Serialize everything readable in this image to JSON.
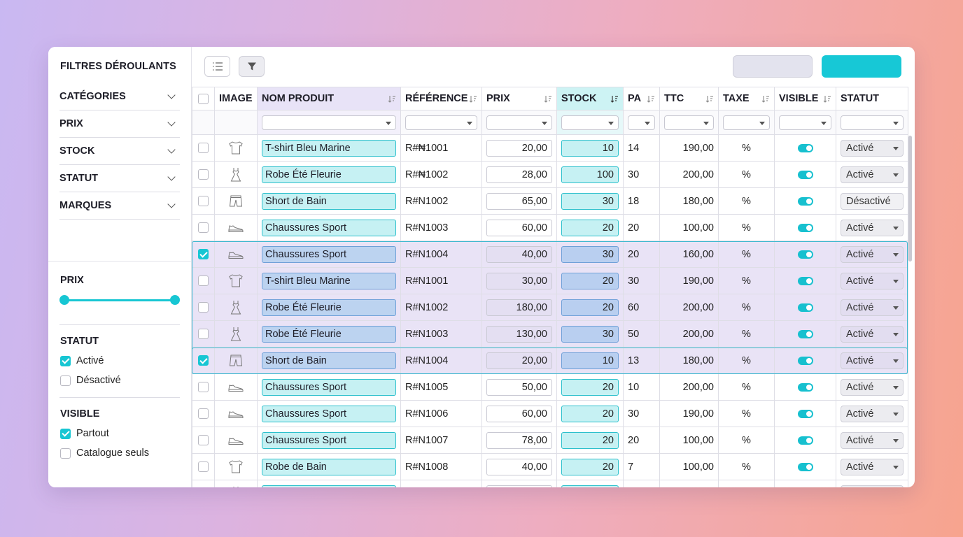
{
  "sidebar": {
    "title": "FILTRES DÉROULANTS",
    "accordions": [
      "CATÉGORIES",
      "PRIX",
      "STOCK",
      "STATUT",
      "MARQUES"
    ],
    "price_heading": "PRIX",
    "price_range": {
      "min_fraction": 0.0,
      "max_fraction": 1.0
    },
    "status_heading": "STATUT",
    "status_options": [
      {
        "label": "Activé",
        "checked": true
      },
      {
        "label": "Désactivé",
        "checked": false
      }
    ],
    "visible_heading": "VISIBLE",
    "visible_options": [
      {
        "label": "Partout",
        "checked": true
      },
      {
        "label": "Catalogue seuls",
        "checked": false
      }
    ]
  },
  "toolbar": {
    "list_icon": "list-icon",
    "filter_icon": "filter-icon"
  },
  "columns": [
    "",
    "IMAGE",
    "NOM PRODUIT",
    "RÉFÉRENCE",
    "PRIX",
    "STOCK",
    "PA",
    "TTC",
    "TAXE",
    "VISIBLE",
    "STATUT"
  ],
  "colors": {
    "accent": "#17c8d6",
    "selection": "#e9e3f6"
  },
  "rows": [
    {
      "checked": false,
      "selected": false,
      "icon": "tshirt-icon",
      "name": "T-shirt Bleu Marine",
      "ref": "R#₦1001",
      "price": "20,00",
      "stock": "10",
      "pa": "14",
      "ttc": "190,00",
      "tax": "%",
      "visible": true,
      "status": "Activé",
      "dropdown": true
    },
    {
      "checked": false,
      "selected": false,
      "icon": "dress-icon",
      "name": "Robe Été Fleurie",
      "ref": "R#₦1002",
      "price": "28,00",
      "stock": "100",
      "pa": "30",
      "ttc": "200,00",
      "tax": "%",
      "visible": true,
      "status": "Activé",
      "dropdown": true
    },
    {
      "checked": false,
      "selected": false,
      "icon": "shorts-icon",
      "name": "Short de Bain",
      "ref": "R#N1002",
      "price": "65,00",
      "stock": "30",
      "pa": "18",
      "ttc": "180,00",
      "tax": "%",
      "visible": true,
      "status": "Désactivé",
      "dropdown": false
    },
    {
      "checked": false,
      "selected": false,
      "icon": "shoe-icon",
      "name": "Chaussures Sport",
      "ref": "R#N1003",
      "price": "60,00",
      "stock": "20",
      "pa": "20",
      "ttc": "100,00",
      "tax": "%",
      "visible": true,
      "status": "Activé",
      "dropdown": true
    },
    {
      "checked": true,
      "selected": true,
      "icon": "shoe-icon",
      "name": "Chaussures Sport",
      "ref": "R#N1004",
      "price": "40,00",
      "stock": "30",
      "pa": "20",
      "ttc": "160,00",
      "tax": "%",
      "visible": true,
      "status": "Activé",
      "dropdown": true
    },
    {
      "checked": false,
      "selected": true,
      "icon": "tshirt-icon",
      "name": "T-shirt Bleu Marine",
      "ref": "R#N1001",
      "price": "30,00",
      "stock": "20",
      "pa": "30",
      "ttc": "190,00",
      "tax": "%",
      "visible": true,
      "status": "Activé",
      "dropdown": true
    },
    {
      "checked": false,
      "selected": true,
      "icon": "dress-icon",
      "name": "Robe Été Fleurie",
      "ref": "R#N1002",
      "price": "180,00",
      "stock": "20",
      "pa": "60",
      "ttc": "200,00",
      "tax": "%",
      "visible": true,
      "status": "Activé",
      "dropdown": true
    },
    {
      "checked": false,
      "selected": true,
      "icon": "dress-icon",
      "name": "Robe Été Fleurie",
      "ref": "R#N1003",
      "price": "130,00",
      "stock": "30",
      "pa": "50",
      "ttc": "200,00",
      "tax": "%",
      "visible": true,
      "status": "Activé",
      "dropdown": true
    },
    {
      "checked": true,
      "selected": true,
      "icon": "shorts-icon",
      "name": "Short de Bain",
      "ref": "R#N1004",
      "price": "20,00",
      "stock": "10",
      "pa": "13",
      "ttc": "180,00",
      "tax": "%",
      "visible": true,
      "status": "Activé",
      "dropdown": true
    },
    {
      "checked": false,
      "selected": false,
      "icon": "shoe-icon",
      "name": "Chaussures Sport",
      "ref": "R#N1005",
      "price": "50,00",
      "stock": "20",
      "pa": "10",
      "ttc": "200,00",
      "tax": "%",
      "visible": true,
      "status": "Activé",
      "dropdown": true
    },
    {
      "checked": false,
      "selected": false,
      "icon": "shoe-icon",
      "name": "Chaussures Sport",
      "ref": "R#N1006",
      "price": "60,00",
      "stock": "20",
      "pa": "30",
      "ttc": "190,00",
      "tax": "%",
      "visible": true,
      "status": "Activé",
      "dropdown": true
    },
    {
      "checked": false,
      "selected": false,
      "icon": "shoe-icon",
      "name": "Chaussures Sport",
      "ref": "R#N1007",
      "price": "78,00",
      "stock": "20",
      "pa": "20",
      "ttc": "100,00",
      "tax": "%",
      "visible": true,
      "status": "Activé",
      "dropdown": true
    },
    {
      "checked": false,
      "selected": false,
      "icon": "tshirt-icon",
      "name": "Robe de Bain",
      "ref": "R#N1008",
      "price": "40,00",
      "stock": "20",
      "pa": "7",
      "ttc": "100,00",
      "tax": "%",
      "visible": true,
      "status": "Activé",
      "dropdown": true
    },
    {
      "checked": false,
      "selected": false,
      "icon": "dress-icon",
      "name": "",
      "ref": "",
      "price": "",
      "stock": "",
      "pa": "",
      "ttc": "",
      "tax": "",
      "visible": true,
      "status": "",
      "dropdown": true
    }
  ]
}
